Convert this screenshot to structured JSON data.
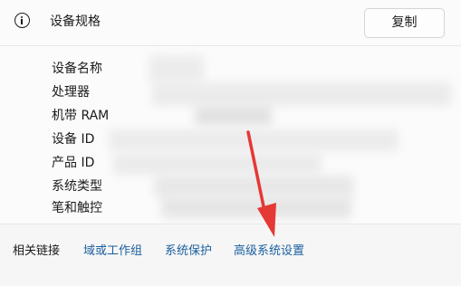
{
  "header": {
    "title": "设备规格",
    "copy_label": "复制",
    "icon": "info-icon"
  },
  "specs": [
    {
      "label": "设备名称"
    },
    {
      "label": "处理器"
    },
    {
      "label": "机带 RAM"
    },
    {
      "label": "设备 ID"
    },
    {
      "label": "产品 ID"
    },
    {
      "label": "系统类型"
    },
    {
      "label": "笔和触控"
    }
  ],
  "related": {
    "label": "相关链接",
    "links": [
      "域或工作组",
      "系统保护",
      "高级系统设置"
    ]
  },
  "colors": {
    "link": "#1a5f9e",
    "annotation_arrow": "#e53935"
  }
}
